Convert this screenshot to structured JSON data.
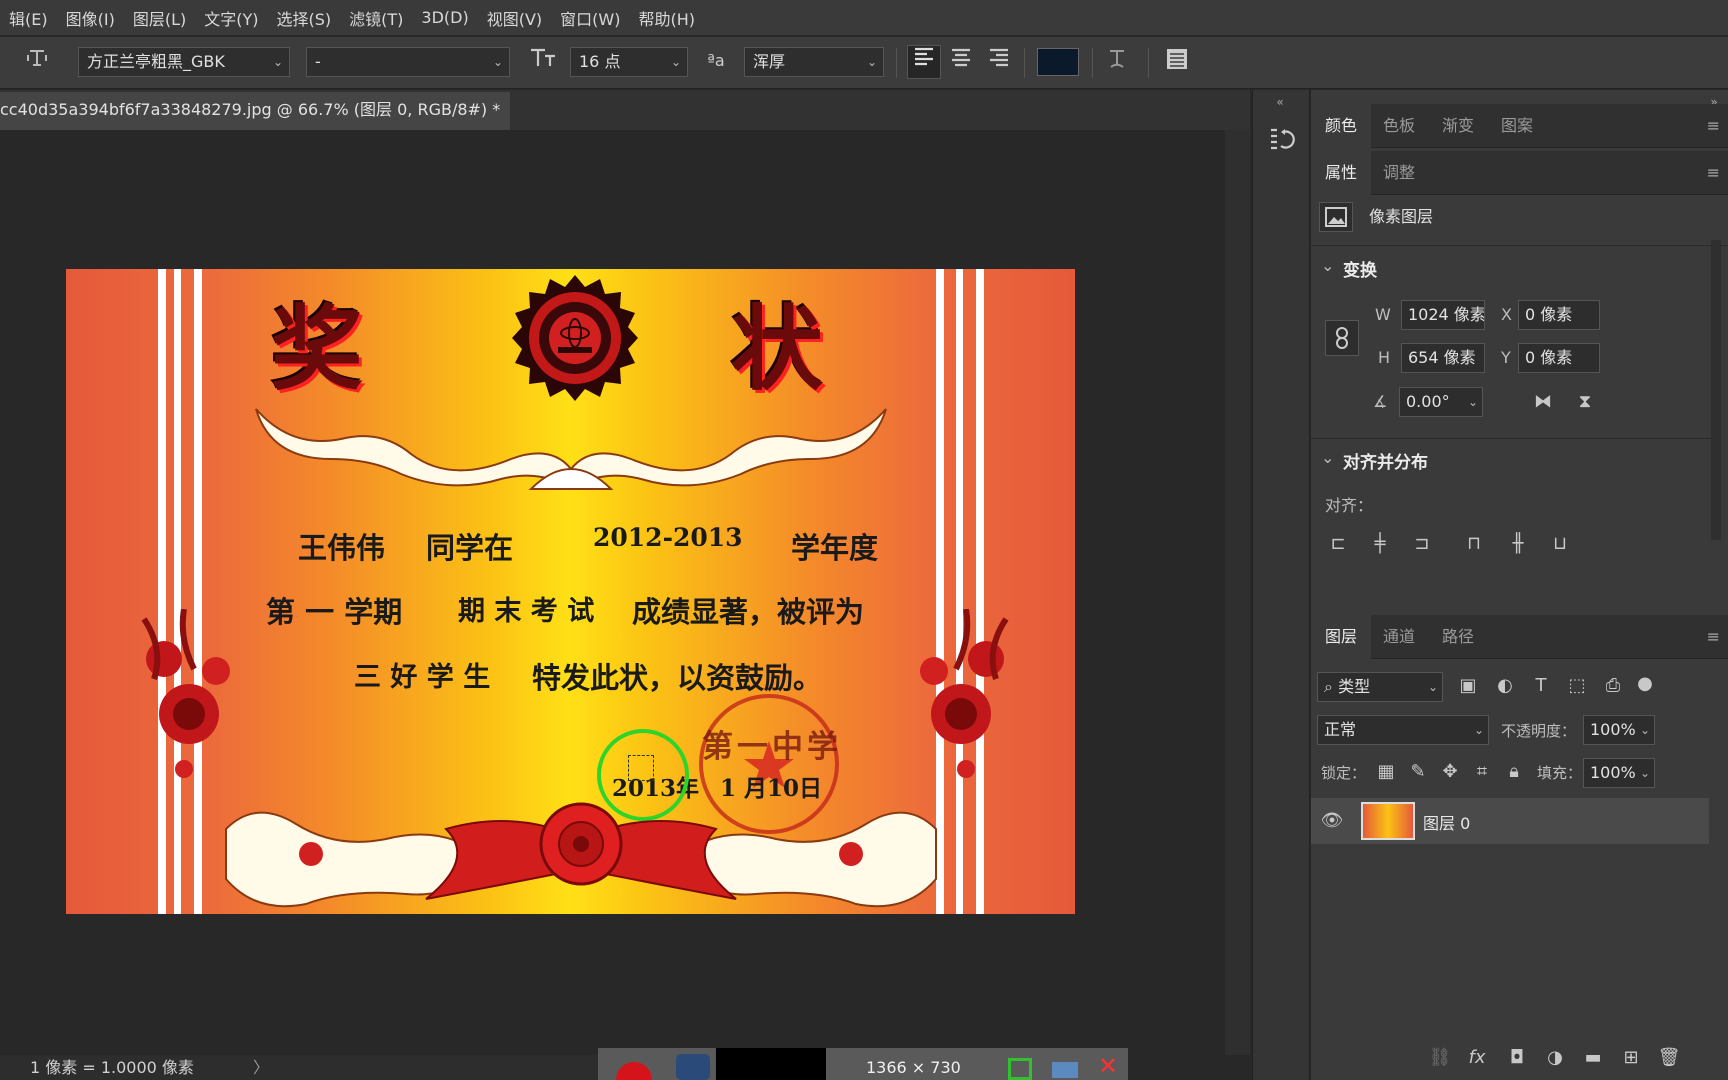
{
  "menu": [
    "辑(E)",
    "图像(I)",
    "图层(L)",
    "文字(Y)",
    "选择(S)",
    "滤镜(T)",
    "3D(D)",
    "视图(V)",
    "窗口(W)",
    "帮助(H)"
  ],
  "options": {
    "font_family": "方正兰亭粗黑_GBK",
    "font_style": "-",
    "font_size": "16 点",
    "aa_label": "ªa",
    "anti_alias": "浑厚",
    "text_color": "#0a1a2a"
  },
  "document": {
    "tab_title": "cc40d35a394bf6f7a33848279.jpg @ 66.7% (图层 0, RGB/8#) *",
    "close_glyph": "×"
  },
  "certificate": {
    "title_left": "奖",
    "title_right": "状",
    "line1_name": "王伟伟",
    "line1_mid": "同学在",
    "line1_year": "2012-2013",
    "line1_end": "学年度",
    "line2_a": "第 一 学期",
    "line2_b": "期 末 考 试",
    "line2_c": "成绩显著，被评为",
    "line3_a": "三 好 学 生",
    "line3_b": "特发此状，以资鼓励。",
    "date_year": "2013年",
    "date_rest": "1 月10日",
    "stamp_text": "第一中学"
  },
  "status": {
    "scale": "1 像素 = 1.0000 像素",
    "arrow": "〉"
  },
  "taskbar": {
    "resolution": "1366 × 730"
  },
  "panels": {
    "color_tabs": [
      "颜色",
      "色板",
      "渐变",
      "图案"
    ],
    "prop_tabs": [
      "属性",
      "调整"
    ],
    "layer_type": "像素图层",
    "transform": {
      "title": "变换",
      "w_label": "W",
      "w_value": "1024 像素",
      "x_label": "X",
      "x_value": "0 像素",
      "h_label": "H",
      "h_value": "654 像素",
      "y_label": "Y",
      "y_value": "0 像素",
      "angle": "0.00°"
    },
    "align": {
      "title": "对齐并分布",
      "label": "对齐："
    },
    "layer_tabs": [
      "图层",
      "通道",
      "路径"
    ],
    "kind": "类型",
    "blend_mode": "正常",
    "opacity_label": "不透明度：",
    "opacity": "100%",
    "lock_label": "锁定：",
    "fill_label": "填充：",
    "fill": "100%",
    "layer_name": "图层 0"
  }
}
